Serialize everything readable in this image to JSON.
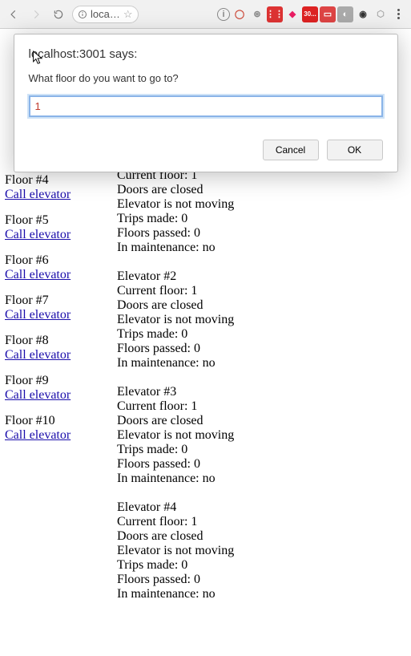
{
  "browser": {
    "address_text": "loca…",
    "extension_tooltip": "30..."
  },
  "dialog": {
    "title": "localhost:3001 says:",
    "message": "What floor do you want to go to?",
    "input_value": "1",
    "cancel_label": "Cancel",
    "ok_label": "OK"
  },
  "floors": [
    {
      "label": "Floor #4",
      "action": "Call elevator"
    },
    {
      "label": "Floor #5",
      "action": "Call elevator"
    },
    {
      "label": "Floor #6",
      "action": "Call elevator"
    },
    {
      "label": "Floor #7",
      "action": "Call elevator"
    },
    {
      "label": "Floor #8",
      "action": "Call elevator"
    },
    {
      "label": "Floor #9",
      "action": "Call elevator"
    },
    {
      "label": "Floor #10",
      "action": "Call elevator"
    }
  ],
  "elevators": [
    {
      "name": "",
      "lines": [
        "Current floor: 1",
        "Doors are closed",
        "Elevator is not moving",
        "Trips made: 0",
        "Floors passed: 0",
        "In maintenance: no"
      ]
    },
    {
      "name": "Elevator #2",
      "lines": [
        "Current floor: 1",
        "Doors are closed",
        "Elevator is not moving",
        "Trips made: 0",
        "Floors passed: 0",
        "In maintenance: no"
      ]
    },
    {
      "name": "Elevator #3",
      "lines": [
        "Current floor: 1",
        "Doors are closed",
        "Elevator is not moving",
        "Trips made: 0",
        "Floors passed: 0",
        "In maintenance: no"
      ]
    },
    {
      "name": "Elevator #4",
      "lines": [
        "Current floor: 1",
        "Doors are closed",
        "Elevator is not moving",
        "Trips made: 0",
        "Floors passed: 0",
        "In maintenance: no"
      ]
    }
  ]
}
